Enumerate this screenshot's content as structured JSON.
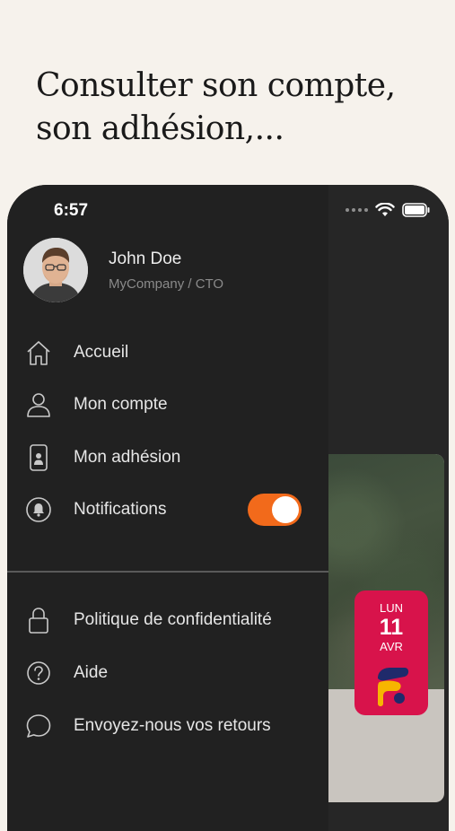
{
  "headline": {
    "line1": "Consulter son compte,",
    "line2": "son adhésion,..."
  },
  "status_bar": {
    "time": "6:57"
  },
  "profile": {
    "name": "John Doe",
    "company": "MyCompany / CTO"
  },
  "menu": {
    "items": [
      {
        "label": "Accueil",
        "icon": "home-icon"
      },
      {
        "label": "Mon compte",
        "icon": "user-icon"
      },
      {
        "label": "Mon adhésion",
        "icon": "membership-card-icon"
      },
      {
        "label": "Notifications",
        "icon": "bell-icon",
        "toggle_on": true
      }
    ],
    "secondary": [
      {
        "label": "Politique de confidentialité",
        "icon": "lock-icon"
      },
      {
        "label": "Aide",
        "icon": "help-icon"
      },
      {
        "label": "Envoyez-nous vos retours",
        "icon": "chat-bubble-icon"
      }
    ]
  },
  "event_card": {
    "day_of_week": "LUN",
    "day": "11",
    "month": "AVR"
  },
  "colors": {
    "background": "#f6f2ec",
    "drawer": "#212121",
    "accent": "#f26a1b",
    "badge": "#d8134b"
  }
}
